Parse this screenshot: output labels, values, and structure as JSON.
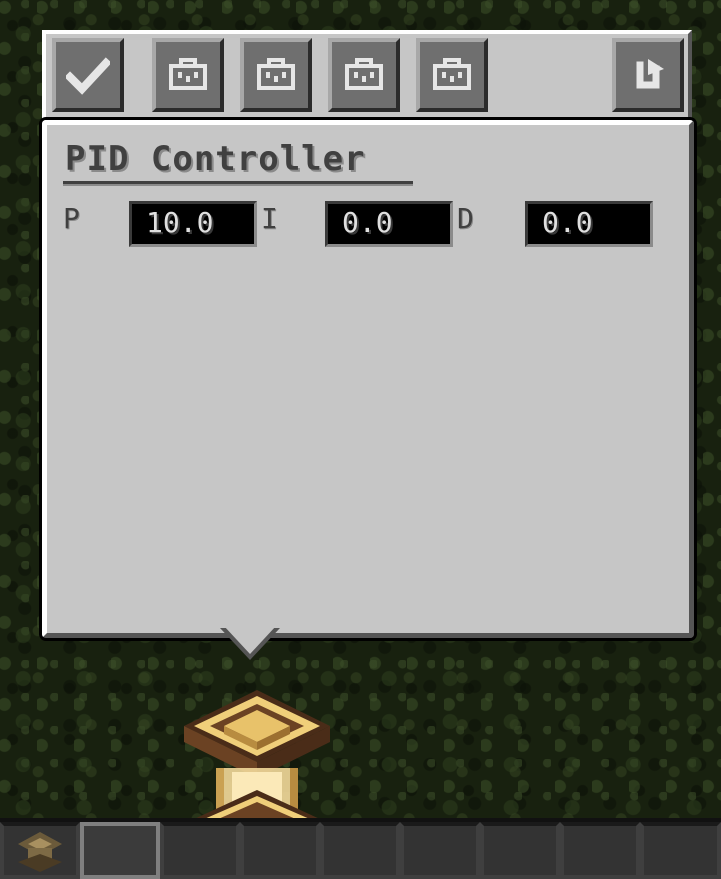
{
  "toolbar": {
    "buttons": [
      {
        "icon": "checkmark-icon",
        "label": "confirm"
      },
      {
        "icon": "briefcase-icon"
      },
      {
        "icon": "briefcase-icon"
      },
      {
        "icon": "briefcase-icon"
      },
      {
        "icon": "briefcase-icon"
      }
    ],
    "refresh_icon": "refresh-icon"
  },
  "panel": {
    "title": "PID Controller",
    "params": [
      {
        "label": "P",
        "value": "10.0"
      },
      {
        "label": "I",
        "value": "0.0"
      },
      {
        "label": "D",
        "value": "0.0"
      }
    ]
  },
  "colors": {
    "panel_bg": "#c6c6c6",
    "field_bg": "#000000",
    "button_bg": "#6f6f6f",
    "text_dark": "#404040",
    "block_gold": "#e8c26a"
  },
  "hotbar": {
    "slot_count": 9,
    "selected_slot": 1
  }
}
